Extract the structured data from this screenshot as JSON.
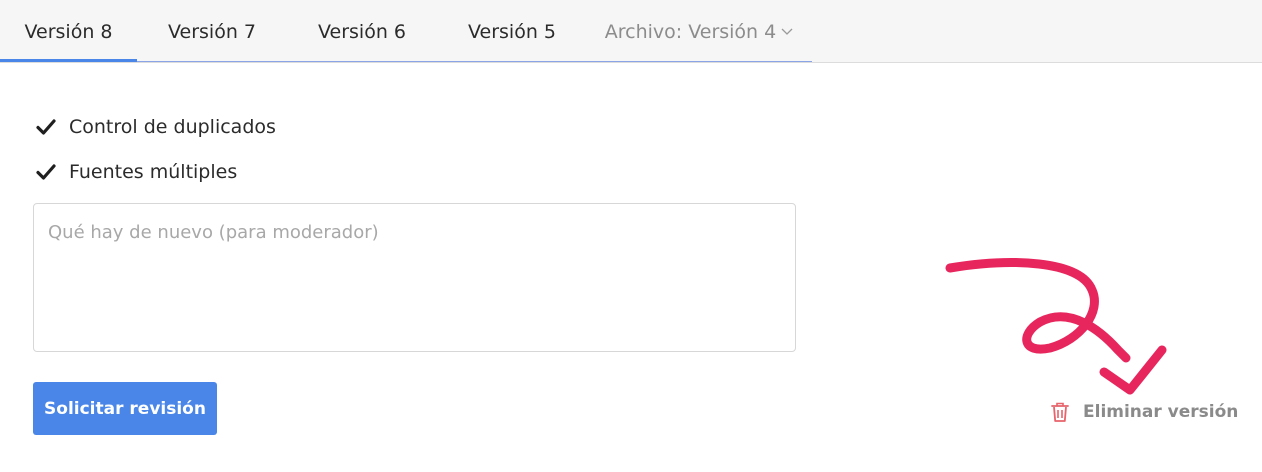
{
  "tabs": [
    {
      "label": "Versión 8",
      "active": true
    },
    {
      "label": "Versión 7",
      "active": false
    },
    {
      "label": "Versión 6",
      "active": false
    },
    {
      "label": "Versión 5",
      "active": false
    }
  ],
  "archive_tab": {
    "label": "Archivo: Versión 4"
  },
  "options": [
    {
      "label": "Control de duplicados",
      "checked": true
    },
    {
      "label": "Fuentes múltiples",
      "checked": true
    }
  ],
  "notes": {
    "placeholder": "Qué hay de nuevo (para moderador)",
    "value": ""
  },
  "submit_button": {
    "label": "Solicitar revisión"
  },
  "delete_link": {
    "label": "Eliminar versión"
  },
  "colors": {
    "accent": "#4a86e8",
    "delete_icon": "#e8636b",
    "annotation": "#e8265e"
  }
}
